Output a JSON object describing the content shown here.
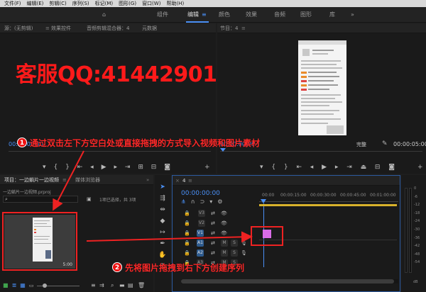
{
  "menu": [
    "文件(F)",
    "编辑(E)",
    "剪辑(C)",
    "序列(S)",
    "标记(M)",
    "图形(G)",
    "窗口(W)",
    "帮助(H)"
  ],
  "workspace_tabs": [
    {
      "label": "组件"
    },
    {
      "label": "编辑"
    },
    {
      "label": "颜色"
    },
    {
      "label": "效果"
    },
    {
      "label": "音频"
    },
    {
      "label": "图形"
    },
    {
      "label": "库"
    }
  ],
  "workspace_more": "»",
  "source_panel": {
    "tabs": [
      "源：(无剪辑)",
      "效果控件",
      "音频剪辑混合器：4",
      "元数据"
    ],
    "timecode": "00:00:00:00"
  },
  "program_panel": {
    "title": "节目：4",
    "timecode_left": "00:00:00:00",
    "fit": "完整",
    "timecode_right": "00:00:05:00"
  },
  "watermark": "客服QQ:41442901",
  "annotations": [
    {
      "num": "1",
      "text": "通过双击左下方空白处或直接拖拽的方式导入视频和图片素材"
    },
    {
      "num": "2",
      "text": "先将图片拖拽到右下方创建序列"
    }
  ],
  "project_panel": {
    "title": "项目：一边躺片一边视频",
    "tab2": "媒体浏览器",
    "file": "一边躺片一边视频.prproj",
    "selection": "1项已选择，共 3项",
    "thumb_duration": "5:00"
  },
  "timeline": {
    "sequence": "4",
    "timecode": "00:00:00:00",
    "ruler": [
      "00:00",
      "00:00:15:00",
      "00:00:30:00",
      "00:00:45:00",
      "00:01:00:00"
    ],
    "tracks": [
      {
        "name": "V3",
        "type": "video"
      },
      {
        "name": "V2",
        "type": "video"
      },
      {
        "name": "V1",
        "type": "video"
      },
      {
        "name": "A1",
        "type": "audio"
      },
      {
        "name": "A2",
        "type": "audio"
      },
      {
        "name": "A3",
        "type": "audio"
      }
    ],
    "meter_labels": [
      "0",
      "-6",
      "-12",
      "-18",
      "-24",
      "-30",
      "-36",
      "-42",
      "-48",
      "-54"
    ],
    "meter_footer": "dB"
  }
}
